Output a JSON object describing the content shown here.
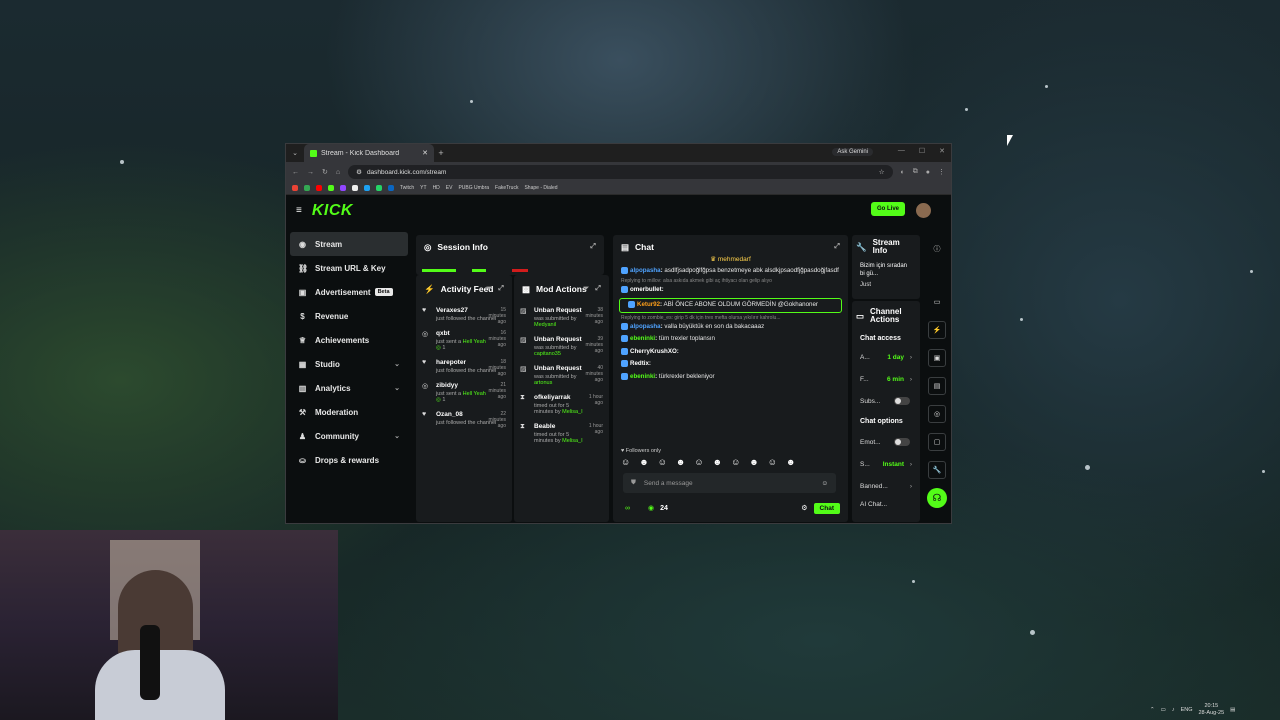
{
  "browser": {
    "tab_title": "Stream - Kick Dashboard",
    "url": "dashboard.kick.com/stream",
    "ask_gemini": "Ask Gemini",
    "bookmarks": [
      "Twitch",
      "YT",
      "HD",
      "EV",
      "PUBG Umbra",
      "FakeTruck",
      "Shape - Dialed"
    ]
  },
  "kick": {
    "logo": "KICK",
    "go_live": "Go Live",
    "sidebar": [
      {
        "label": "Stream",
        "icon": "stream-icon"
      },
      {
        "label": "Stream URL & Key",
        "icon": "link-icon"
      },
      {
        "label": "Advertisement",
        "icon": "ad-icon",
        "badge": "Beta"
      },
      {
        "label": "Revenue",
        "icon": "revenue-icon"
      },
      {
        "label": "Achievements",
        "icon": "trophy-icon"
      },
      {
        "label": "Studio",
        "icon": "studio-icon"
      },
      {
        "label": "Analytics",
        "icon": "analytics-icon"
      },
      {
        "label": "Moderation",
        "icon": "moderation-icon"
      },
      {
        "label": "Community",
        "icon": "community-icon"
      },
      {
        "label": "Drops & rewards",
        "icon": "drops-icon"
      }
    ],
    "session_info": {
      "title": "Session Info"
    },
    "activity_feed": {
      "title": "Activity Feed",
      "items": [
        {
          "name": "Veraxes27",
          "time": "15 minutes ago",
          "text": "just followed the channel",
          "type": "follow"
        },
        {
          "name": "qxbt",
          "time": "16 minutes ago",
          "text": "just sent a",
          "extra": "Hell Yeah",
          "count": "1",
          "type": "gift"
        },
        {
          "name": "harepoter",
          "time": "18 minutes ago",
          "text": "just followed the channel",
          "type": "follow"
        },
        {
          "name": "zibidyy",
          "time": "21 minutes ago",
          "text": "just sent a",
          "extra": "Hell Yeah",
          "count": "1",
          "type": "gift"
        },
        {
          "name": "Ozan_08",
          "time": "22 minutes ago",
          "text": "just followed the channel",
          "type": "follow"
        }
      ]
    },
    "mod_actions": {
      "title": "Mod Actions",
      "items": [
        {
          "name": "Unban Request",
          "time": "38 minutes ago",
          "text": "was submitted by",
          "by": "Medyanil"
        },
        {
          "name": "Unban Request",
          "time": "39 minutes ago",
          "text": "was submitted by",
          "by": "capitano35"
        },
        {
          "name": "Unban Request",
          "time": "40 minutes ago",
          "text": "was submitted by",
          "by": "artonus"
        },
        {
          "name": "ofkeliyarrak",
          "time": "1 hour ago",
          "text": "timed out for 5 minutes by",
          "by": "Melisa_I"
        },
        {
          "name": "Beable",
          "time": "1 hour ago",
          "text": "timed out for 5 minutes by",
          "by": "Melisa_I"
        }
      ]
    },
    "chat": {
      "title": "Chat",
      "pinned": "mehmedarf",
      "messages": [
        {
          "user": "alpopasha",
          "text": "asdlfjsadpoğlfğpsa benzetmeye abk alsdkjpsaodfjğpasdoğjfasdf",
          "color": "#4fa3ff"
        },
        {
          "reply": "Replying to millov: alsa askıda akmek gibi aç ihtiyacı olan gelip alıyo"
        },
        {
          "user": "omerbullet",
          "text": "",
          "color": "#ffffff"
        },
        {
          "user": "Ketur92",
          "text": "ABİ ÖNCE ABONE OLDUM GÖRMEDİN @Gokhanoner",
          "color": "#ff9f1a",
          "highlight": true
        },
        {
          "reply": "Replying to zombie_es: girip 5 dk için trex mefta olursa yıkılırır kahrolu..."
        },
        {
          "user": "alpopasha",
          "text": "valla büyüktük en son da bakacaaaz",
          "color": "#4fa3ff"
        },
        {
          "user": "ebeninki",
          "text": "tüm trexler toplansın",
          "color": "#53fc18"
        },
        {
          "user": "CherryKrushXO",
          "text": "",
          "color": "#ffffff"
        },
        {
          "user": "Redtix",
          "text": "",
          "color": "#ffffff"
        },
        {
          "user": "ebeninki",
          "text": "türkrexler bekleniyor",
          "color": "#53fc18"
        }
      ],
      "followers_only": "Followers only",
      "placeholder": "Send a message",
      "viewers": "24",
      "chat_button": "Chat"
    },
    "stream_info": {
      "title": "Stream Info",
      "text": "Bizim için sıradan bi gü...",
      "sub": "Just"
    },
    "channel_actions": {
      "title": "Channel Actions",
      "chat_access": "Chat access",
      "rows": [
        {
          "label": "A...",
          "value": "1 day"
        },
        {
          "label": "F...",
          "value": "6 min"
        },
        {
          "label": "Subs...",
          "toggle": true
        }
      ],
      "chat_options": "Chat options",
      "rows2": [
        {
          "label": "Emot...",
          "toggle": true
        },
        {
          "label": "S...",
          "value": "Instant"
        },
        {
          "label": "Banned...",
          "value": ""
        },
        {
          "label": "AI Chat..."
        }
      ]
    }
  },
  "taskbar": {
    "lang": "ENG",
    "time": "20:15",
    "date": "28-Aug-25"
  }
}
